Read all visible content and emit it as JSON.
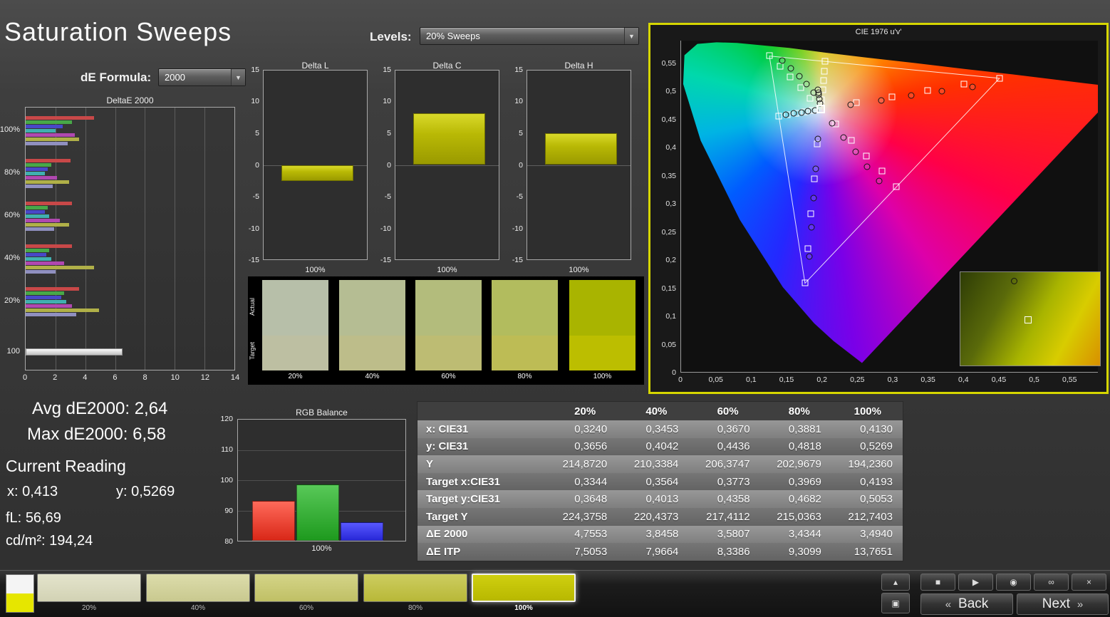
{
  "header": {
    "title": "Saturation Sweeps",
    "levels_label": "Levels:",
    "levels_value": "20% Sweeps",
    "de_formula_label": "dE Formula:",
    "de_formula_value": "2000"
  },
  "charts": {
    "deltae2000": {
      "type": "bar",
      "orientation": "horizontal",
      "title": "DeltaE 2000",
      "xlim": [
        0,
        14
      ],
      "x_ticks": [
        0,
        2,
        4,
        6,
        8,
        10,
        12,
        14
      ],
      "bar_colors": [
        "#c84848",
        "#48a848",
        "#4848c8",
        "#40b0b0",
        "#b048b0",
        "#b0b048",
        "#9090c0"
      ],
      "groups": [
        {
          "label": "100%",
          "values": [
            4.6,
            3.1,
            2.5,
            2.0,
            3.3,
            3.6,
            2.8
          ]
        },
        {
          "label": "80%",
          "values": [
            3.0,
            1.7,
            1.5,
            1.3,
            2.1,
            2.9,
            1.8
          ]
        },
        {
          "label": "60%",
          "values": [
            3.1,
            1.5,
            1.3,
            1.6,
            2.3,
            2.9,
            1.9
          ]
        },
        {
          "label": "40%",
          "values": [
            3.1,
            1.6,
            1.4,
            1.7,
            2.6,
            4.6,
            2.0
          ]
        },
        {
          "label": "20%",
          "values": [
            3.6,
            2.6,
            2.4,
            2.7,
            3.1,
            4.9,
            3.4
          ]
        },
        {
          "label": "100",
          "values": [
            6.5
          ]
        }
      ]
    },
    "delta_l": {
      "type": "bar",
      "title": "Delta L",
      "ylim": [
        -15,
        15
      ],
      "y_ticks": [
        15,
        10,
        5,
        0,
        -5,
        -10,
        -15
      ],
      "category": "100%",
      "value": -2.5
    },
    "delta_c": {
      "type": "bar",
      "title": "Delta C",
      "ylim": [
        -15,
        15
      ],
      "y_ticks": [
        15,
        10,
        5,
        0,
        -5,
        -10,
        -15
      ],
      "category": "100%",
      "value": 8.2
    },
    "delta_h": {
      "type": "bar",
      "title": "Delta H",
      "ylim": [
        -15,
        15
      ],
      "y_ticks": [
        15,
        10,
        5,
        0,
        -5,
        -10,
        -15
      ],
      "category": "100%",
      "value": 5.0
    },
    "rgb_balance": {
      "type": "bar",
      "title": "RGB Balance",
      "ylim": [
        80,
        120
      ],
      "y_ticks": [
        120,
        110,
        100,
        90,
        80
      ],
      "category": "100%",
      "series": [
        {
          "name": "Red",
          "value": 93.2,
          "color": "#d92818",
          "color_light": "#ff6a5a"
        },
        {
          "name": "Green",
          "value": 98.6,
          "color": "#1e9a1e",
          "color_light": "#58c858"
        },
        {
          "name": "Blue",
          "value": 86.2,
          "color": "#2828d8",
          "color_light": "#5858ff"
        }
      ]
    },
    "cie": {
      "type": "scatter",
      "title": "CIE 1976 u'v'",
      "axis_max": 0.59,
      "axis_ticks": {
        "values": [
          0,
          0.05,
          0.1,
          0.15,
          0.2,
          0.25,
          0.3,
          0.35,
          0.4,
          0.45,
          0.5,
          0.55
        ],
        "labels": [
          "0",
          "0,05",
          "0,1",
          "0,15",
          "0,2",
          "0,25",
          "0,3",
          "0,35",
          "0,4",
          "0,45",
          "0,5",
          "0,55"
        ]
      },
      "whitepoint": [
        0.198,
        0.468
      ],
      "gamut_triangle": [
        [
          0.4507,
          0.5229
        ],
        [
          0.125,
          0.5625
        ],
        [
          0.1754,
          0.1579
        ]
      ],
      "target_sweeps": {
        "red": [
          [
            0.248,
            0.479
          ],
          [
            0.299,
            0.49
          ],
          [
            0.349,
            0.501
          ],
          [
            0.4,
            0.512
          ],
          [
            0.451,
            0.523
          ]
        ],
        "green": [
          [
            0.183,
            0.487
          ],
          [
            0.169,
            0.506
          ],
          [
            0.154,
            0.525
          ],
          [
            0.14,
            0.544
          ],
          [
            0.125,
            0.563
          ]
        ],
        "blue": [
          [
            0.193,
            0.406
          ],
          [
            0.189,
            0.344
          ],
          [
            0.184,
            0.282
          ],
          [
            0.18,
            0.22
          ],
          [
            0.175,
            0.158
          ]
        ],
        "cyan": [
          [
            0.186,
            0.466
          ],
          [
            0.174,
            0.463
          ],
          [
            0.162,
            0.461
          ],
          [
            0.15,
            0.458
          ],
          [
            0.138,
            0.456
          ]
        ],
        "magenta": [
          [
            0.219,
            0.441
          ],
          [
            0.241,
            0.413
          ],
          [
            0.262,
            0.385
          ],
          [
            0.284,
            0.358
          ],
          [
            0.305,
            0.33
          ]
        ],
        "yellow": [
          [
            0.199,
            0.485
          ],
          [
            0.201,
            0.502
          ],
          [
            0.202,
            0.519
          ],
          [
            0.203,
            0.536
          ],
          [
            0.204,
            0.553
          ]
        ]
      },
      "measured_sweeps": {
        "red": [
          [
            0.24,
            0.476
          ],
          [
            0.283,
            0.484
          ],
          [
            0.326,
            0.492
          ],
          [
            0.369,
            0.5
          ],
          [
            0.412,
            0.508
          ]
        ],
        "green": [
          [
            0.188,
            0.498
          ],
          [
            0.178,
            0.512
          ],
          [
            0.167,
            0.527
          ],
          [
            0.155,
            0.541
          ],
          [
            0.143,
            0.555
          ]
        ],
        "blue": [
          [
            0.194,
            0.415
          ],
          [
            0.191,
            0.362
          ],
          [
            0.188,
            0.31
          ],
          [
            0.185,
            0.258
          ],
          [
            0.182,
            0.205
          ]
        ],
        "cyan": [
          [
            0.19,
            0.466
          ],
          [
            0.18,
            0.464
          ],
          [
            0.17,
            0.462
          ],
          [
            0.159,
            0.46
          ],
          [
            0.148,
            0.458
          ]
        ],
        "magenta": [
          [
            0.214,
            0.443
          ],
          [
            0.23,
            0.418
          ],
          [
            0.247,
            0.392
          ],
          [
            0.263,
            0.366
          ],
          [
            0.28,
            0.34
          ]
        ],
        "yellow": [
          [
            0.197,
            0.478
          ],
          [
            0.196,
            0.486
          ],
          [
            0.195,
            0.493
          ],
          [
            0.195,
            0.498
          ],
          [
            0.194,
            0.502
          ]
        ]
      }
    }
  },
  "comparison_swatches": {
    "actual_label": "Actual",
    "target_label": "Target",
    "items": [
      {
        "label": "20%",
        "actual": "#b7bfa9",
        "target": "#bdbfa2"
      },
      {
        "label": "40%",
        "actual": "#b5bd93",
        "target": "#bdbd8a"
      },
      {
        "label": "60%",
        "actual": "#b3bc7c",
        "target": "#bdbc73"
      },
      {
        "label": "80%",
        "actual": "#b2bc5e",
        "target": "#bdbc55"
      },
      {
        "label": "100%",
        "actual": "#a9b400",
        "target": "#bcbe00"
      }
    ]
  },
  "readings": {
    "avg_label": "Avg dE2000:",
    "avg_value": "2,64",
    "max_label": "Max dE2000:",
    "max_value": "6,58",
    "current_title": "Current Reading",
    "x_label": "x:",
    "x_value": "0,413",
    "y_label": "y:",
    "y_value": "0,5269",
    "fl_label": "fL:",
    "fl_value": "56,69",
    "cdm2_label": "cd/m²:",
    "cdm2_value": "194,24"
  },
  "table": {
    "columns": [
      "20%",
      "40%",
      "60%",
      "80%",
      "100%"
    ],
    "rows": [
      {
        "label": "x: CIE31",
        "values": [
          "0,3240",
          "0,3453",
          "0,3670",
          "0,3881",
          "0,4130"
        ]
      },
      {
        "label": "y: CIE31",
        "values": [
          "0,3656",
          "0,4042",
          "0,4436",
          "0,4818",
          "0,5269"
        ]
      },
      {
        "label": "Y",
        "values": [
          "214,8720",
          "210,3384",
          "206,3747",
          "202,9679",
          "194,2360"
        ]
      },
      {
        "label": "Target x:CIE31",
        "values": [
          "0,3344",
          "0,3564",
          "0,3773",
          "0,3969",
          "0,4193"
        ]
      },
      {
        "label": "Target y:CIE31",
        "values": [
          "0,3648",
          "0,4013",
          "0,4358",
          "0,4682",
          "0,5053"
        ]
      },
      {
        "label": "Target Y",
        "values": [
          "224,3758",
          "220,4373",
          "217,4112",
          "215,0363",
          "212,7403"
        ]
      },
      {
        "label": "ΔE 2000",
        "values": [
          "4,7553",
          "3,8458",
          "3,5807",
          "3,4344",
          "3,4940"
        ]
      },
      {
        "label": "ΔE ITP",
        "values": [
          "7,5053",
          "7,9664",
          "8,3386",
          "9,3099",
          "13,7651"
        ]
      }
    ]
  },
  "bottom_bar": {
    "swatches": [
      {
        "label": "20%",
        "color_top": "#e4e4cc",
        "color_bottom": "#d2d2b4",
        "selected": false
      },
      {
        "label": "40%",
        "color_top": "#dcdcab",
        "color_bottom": "#c9c98f",
        "selected": false
      },
      {
        "label": "60%",
        "color_top": "#d4d488",
        "color_bottom": "#c0c065",
        "selected": false
      },
      {
        "label": "80%",
        "color_top": "#cdcd60",
        "color_bottom": "#b8b838",
        "selected": false
      },
      {
        "label": "100%",
        "color_top": "#cfcf10",
        "color_bottom": "#b8b800",
        "selected": true
      }
    ],
    "side_buttons": [
      {
        "name": "expand",
        "glyph": "▴"
      },
      {
        "name": "pattern-window",
        "glyph": "▣"
      }
    ],
    "transport_buttons": [
      {
        "name": "stop",
        "glyph": "■"
      },
      {
        "name": "play",
        "glyph": "▶"
      },
      {
        "name": "meter",
        "glyph": "◉"
      },
      {
        "name": "continuous",
        "glyph": "∞"
      },
      {
        "name": "close",
        "glyph": "×"
      }
    ],
    "back_chevron": "«",
    "back_label": "Back",
    "next_label": "Next",
    "next_chevron": "»"
  }
}
